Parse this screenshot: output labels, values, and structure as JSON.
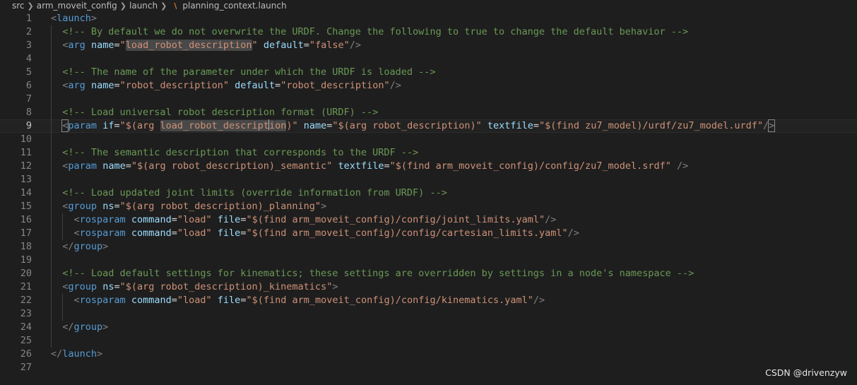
{
  "breadcrumb": {
    "items": [
      "src",
      "arm_moveit_config",
      "launch"
    ],
    "file_name": "planning_context.launch",
    "file_icon": "rss-icon",
    "separator_icon": "chevron-right-icon"
  },
  "editor": {
    "current_line": 9,
    "lines": [
      {
        "n": "1",
        "tokens": [
          {
            "t": "<",
            "c": "punc"
          },
          {
            "t": "launch",
            "c": "tag"
          },
          {
            "t": ">",
            "c": "punc"
          }
        ]
      },
      {
        "n": "2",
        "tokens": [
          {
            "t": "  "
          },
          {
            "t": "<!-- By default we do not overwrite the URDF. Change the following to true to change the default behavior -->",
            "c": "com"
          }
        ]
      },
      {
        "n": "3",
        "tokens": [
          {
            "t": "  "
          },
          {
            "t": "<",
            "c": "punc"
          },
          {
            "t": "arg",
            "c": "tag"
          },
          {
            "t": " "
          },
          {
            "t": "name",
            "c": "attr"
          },
          {
            "t": "=",
            "c": "eq"
          },
          {
            "t": "\"",
            "c": "str"
          },
          {
            "t": "load_robot_description",
            "c": "str",
            "hl": true
          },
          {
            "t": "\"",
            "c": "str"
          },
          {
            "t": " "
          },
          {
            "t": "default",
            "c": "attr"
          },
          {
            "t": "=",
            "c": "eq"
          },
          {
            "t": "\"false\"",
            "c": "str"
          },
          {
            "t": "/>",
            "c": "punc"
          }
        ]
      },
      {
        "n": "4",
        "tokens": []
      },
      {
        "n": "5",
        "tokens": [
          {
            "t": "  "
          },
          {
            "t": "<!-- The name of the parameter under which the URDF is loaded -->",
            "c": "com"
          }
        ]
      },
      {
        "n": "6",
        "tokens": [
          {
            "t": "  "
          },
          {
            "t": "<",
            "c": "punc"
          },
          {
            "t": "arg",
            "c": "tag"
          },
          {
            "t": " "
          },
          {
            "t": "name",
            "c": "attr"
          },
          {
            "t": "=",
            "c": "eq"
          },
          {
            "t": "\"robot_description\"",
            "c": "str"
          },
          {
            "t": " "
          },
          {
            "t": "default",
            "c": "attr"
          },
          {
            "t": "=",
            "c": "eq"
          },
          {
            "t": "\"robot_description\"",
            "c": "str"
          },
          {
            "t": "/>",
            "c": "punc"
          }
        ]
      },
      {
        "n": "7",
        "tokens": []
      },
      {
        "n": "8",
        "tokens": [
          {
            "t": "  "
          },
          {
            "t": "<!-- Load universal robot description format (URDF) -->",
            "c": "com"
          }
        ]
      },
      {
        "n": "9",
        "tokens": [
          {
            "t": "  "
          },
          {
            "t": "<",
            "c": "punc",
            "box": true
          },
          {
            "t": "param",
            "c": "tag"
          },
          {
            "t": " "
          },
          {
            "t": "if",
            "c": "attr"
          },
          {
            "t": "=",
            "c": "eq"
          },
          {
            "t": "\"$(arg ",
            "c": "str"
          },
          {
            "t": "load_robot_descript",
            "c": "str",
            "hl": true
          },
          {
            "t": "i",
            "c": "str",
            "hl": true,
            "cursor": true
          },
          {
            "t": "on",
            "c": "str",
            "hl": true
          },
          {
            "t": ")\"",
            "c": "str"
          },
          {
            "t": " "
          },
          {
            "t": "name",
            "c": "attr"
          },
          {
            "t": "=",
            "c": "eq"
          },
          {
            "t": "\"$(arg robot_description)\"",
            "c": "str"
          },
          {
            "t": " "
          },
          {
            "t": "textfile",
            "c": "attr"
          },
          {
            "t": "=",
            "c": "eq"
          },
          {
            "t": "\"$(find zu7_model)/urdf/zu7_model.urdf\"",
            "c": "str"
          },
          {
            "t": "/",
            "c": "punc"
          },
          {
            "t": ">",
            "c": "punc",
            "box": true
          }
        ]
      },
      {
        "n": "10",
        "tokens": []
      },
      {
        "n": "11",
        "tokens": [
          {
            "t": "  "
          },
          {
            "t": "<!-- The semantic description that corresponds to the URDF -->",
            "c": "com"
          }
        ]
      },
      {
        "n": "12",
        "tokens": [
          {
            "t": "  "
          },
          {
            "t": "<",
            "c": "punc"
          },
          {
            "t": "param",
            "c": "tag"
          },
          {
            "t": " "
          },
          {
            "t": "name",
            "c": "attr"
          },
          {
            "t": "=",
            "c": "eq"
          },
          {
            "t": "\"$(arg robot_description)_semantic\"",
            "c": "str"
          },
          {
            "t": " "
          },
          {
            "t": "textfile",
            "c": "attr"
          },
          {
            "t": "=",
            "c": "eq"
          },
          {
            "t": "\"$(find arm_moveit_config)/config/zu7_model.srdf\"",
            "c": "str"
          },
          {
            "t": " "
          },
          {
            "t": "/>",
            "c": "punc"
          }
        ]
      },
      {
        "n": "13",
        "tokens": []
      },
      {
        "n": "14",
        "tokens": [
          {
            "t": "  "
          },
          {
            "t": "<!-- Load updated joint limits (override information from URDF) -->",
            "c": "com"
          }
        ]
      },
      {
        "n": "15",
        "tokens": [
          {
            "t": "  "
          },
          {
            "t": "<",
            "c": "punc"
          },
          {
            "t": "group",
            "c": "tag"
          },
          {
            "t": " "
          },
          {
            "t": "ns",
            "c": "attr"
          },
          {
            "t": "=",
            "c": "eq"
          },
          {
            "t": "\"$(arg robot_description)_planning\"",
            "c": "str"
          },
          {
            "t": ">",
            "c": "punc"
          }
        ]
      },
      {
        "n": "16",
        "tokens": [
          {
            "t": "    "
          },
          {
            "t": "<",
            "c": "punc"
          },
          {
            "t": "rosparam",
            "c": "tag"
          },
          {
            "t": " "
          },
          {
            "t": "command",
            "c": "attr"
          },
          {
            "t": "=",
            "c": "eq"
          },
          {
            "t": "\"load\"",
            "c": "str"
          },
          {
            "t": " "
          },
          {
            "t": "file",
            "c": "attr"
          },
          {
            "t": "=",
            "c": "eq"
          },
          {
            "t": "\"$(find arm_moveit_config)/config/joint_limits.yaml\"",
            "c": "str"
          },
          {
            "t": "/>",
            "c": "punc"
          }
        ]
      },
      {
        "n": "17",
        "tokens": [
          {
            "t": "    "
          },
          {
            "t": "<",
            "c": "punc"
          },
          {
            "t": "rosparam",
            "c": "tag"
          },
          {
            "t": " "
          },
          {
            "t": "command",
            "c": "attr"
          },
          {
            "t": "=",
            "c": "eq"
          },
          {
            "t": "\"load\"",
            "c": "str"
          },
          {
            "t": " "
          },
          {
            "t": "file",
            "c": "attr"
          },
          {
            "t": "=",
            "c": "eq"
          },
          {
            "t": "\"$(find arm_moveit_config)/config/cartesian_limits.yaml\"",
            "c": "str"
          },
          {
            "t": "/>",
            "c": "punc"
          }
        ]
      },
      {
        "n": "18",
        "tokens": [
          {
            "t": "  "
          },
          {
            "t": "</",
            "c": "punc"
          },
          {
            "t": "group",
            "c": "tag"
          },
          {
            "t": ">",
            "c": "punc"
          }
        ]
      },
      {
        "n": "19",
        "tokens": []
      },
      {
        "n": "20",
        "tokens": [
          {
            "t": "  "
          },
          {
            "t": "<!-- Load default settings for kinematics; these settings are overridden by settings in a node's namespace -->",
            "c": "com"
          }
        ]
      },
      {
        "n": "21",
        "tokens": [
          {
            "t": "  "
          },
          {
            "t": "<",
            "c": "punc"
          },
          {
            "t": "group",
            "c": "tag"
          },
          {
            "t": " "
          },
          {
            "t": "ns",
            "c": "attr"
          },
          {
            "t": "=",
            "c": "eq"
          },
          {
            "t": "\"$(arg robot_description)_kinematics\"",
            "c": "str"
          },
          {
            "t": ">",
            "c": "punc"
          }
        ]
      },
      {
        "n": "22",
        "tokens": [
          {
            "t": "    "
          },
          {
            "t": "<",
            "c": "punc"
          },
          {
            "t": "rosparam",
            "c": "tag"
          },
          {
            "t": " "
          },
          {
            "t": "command",
            "c": "attr"
          },
          {
            "t": "=",
            "c": "eq"
          },
          {
            "t": "\"load\"",
            "c": "str"
          },
          {
            "t": " "
          },
          {
            "t": "file",
            "c": "attr"
          },
          {
            "t": "=",
            "c": "eq"
          },
          {
            "t": "\"$(find arm_moveit_config)/config/kinematics.yaml\"",
            "c": "str"
          },
          {
            "t": "/>",
            "c": "punc"
          }
        ]
      },
      {
        "n": "23",
        "tokens": []
      },
      {
        "n": "24",
        "tokens": [
          {
            "t": "  "
          },
          {
            "t": "</",
            "c": "punc"
          },
          {
            "t": "group",
            "c": "tag"
          },
          {
            "t": ">",
            "c": "punc"
          }
        ]
      },
      {
        "n": "25",
        "tokens": []
      },
      {
        "n": "26",
        "tokens": [
          {
            "t": "</",
            "c": "punc"
          },
          {
            "t": "launch",
            "c": "tag"
          },
          {
            "t": ">",
            "c": "punc"
          }
        ]
      },
      {
        "n": "27",
        "tokens": []
      }
    ]
  },
  "watermark": "CSDN @drivenzyw"
}
